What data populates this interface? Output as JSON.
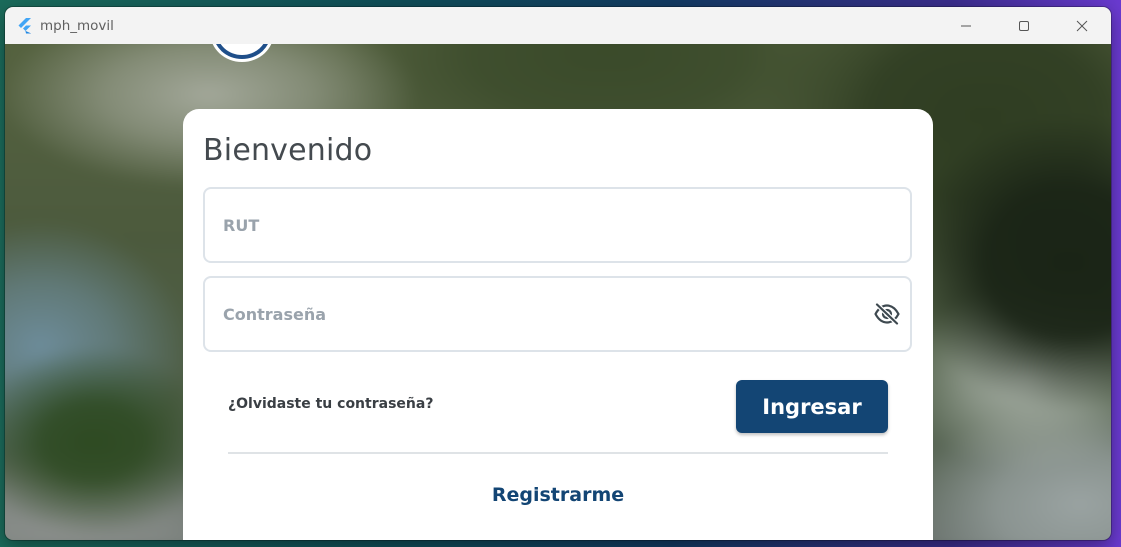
{
  "window": {
    "title": "mph_movil",
    "app_icon": "flutter-icon",
    "controls": [
      "minimize-icon",
      "maximize-icon",
      "close-icon"
    ]
  },
  "login": {
    "heading": "Bienvenido",
    "rut": {
      "placeholder": "RUT",
      "value": ""
    },
    "password": {
      "placeholder": "Contraseña",
      "value": "",
      "toggle_icon": "eye-off-icon"
    },
    "forgot_label": "¿Olvidaste tu contraseña?",
    "submit_label": "Ingresar",
    "register_label": "Registrarme"
  },
  "colors": {
    "primary": "#134574",
    "field_border": "#dde3e9",
    "placeholder": "#9aa3ac",
    "heading": "#444a4f"
  }
}
